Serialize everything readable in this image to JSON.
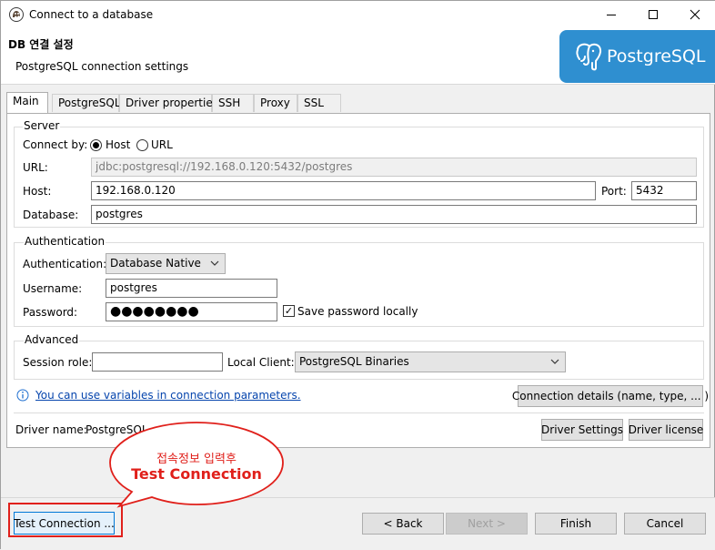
{
  "window": {
    "title": "Connect to a database"
  },
  "header": {
    "title": "DB 연결 설정",
    "subtitle": "PostgreSQL connection settings",
    "logo_text": "PostgreSQL",
    "logo_color": "#2f8fd0"
  },
  "tabs": [
    "Main",
    "PostgreSQL",
    "Driver properties",
    "SSH",
    "Proxy",
    "SSL"
  ],
  "server": {
    "group_label": "Server",
    "connect_by_label": "Connect by:",
    "option_host": "Host",
    "option_url": "URL",
    "selected": "Host",
    "url_label": "URL:",
    "url_value": "jdbc:postgresql://192.168.0.120:5432/postgres",
    "host_label": "Host:",
    "host_value": "192.168.0.120",
    "port_label": "Port:",
    "port_value": "5432",
    "database_label": "Database:",
    "database_value": "postgres"
  },
  "auth": {
    "group_label": "Authentication",
    "auth_label": "Authentication:",
    "auth_value": "Database Native",
    "username_label": "Username:",
    "username_value": "postgres",
    "password_label": "Password:",
    "password_value": "●●●●●●●●",
    "save_password_label": "Save password locally",
    "save_password_checked": true
  },
  "advanced": {
    "group_label": "Advanced",
    "session_role_label": "Session role:",
    "session_role_value": "",
    "local_client_label": "Local Client:",
    "local_client_value": "PostgreSQL Binaries"
  },
  "info_link": "You can use variables in connection parameters.",
  "connection_details_button": "Connection details (name, type, ... )",
  "driver": {
    "name_label": "Driver name:",
    "name_value": "PostgreSQL",
    "settings_button": "Driver Settings",
    "license_button": "Driver license"
  },
  "annotation": {
    "line1": "접속정보 입력후",
    "line2": "Test Connection",
    "color": "#e0201b"
  },
  "footer": {
    "test_connection": "Test Connection ...",
    "back": "< Back",
    "next": "Next >",
    "finish": "Finish",
    "cancel": "Cancel"
  }
}
